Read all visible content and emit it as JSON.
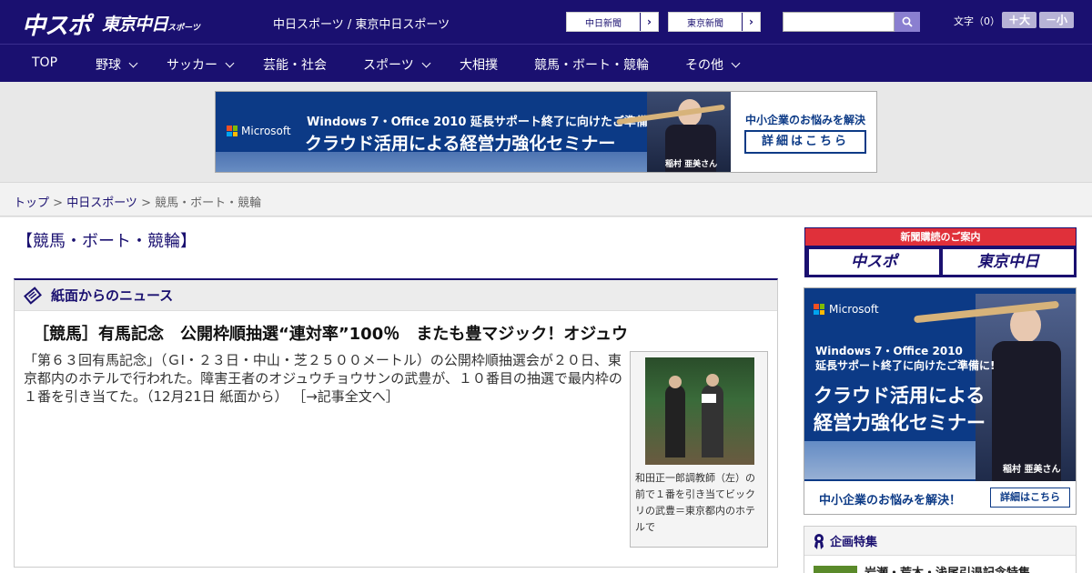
{
  "header": {
    "logo_main": "中スポ",
    "logo_sub": "東京中日",
    "logo_sub_small": "スポーツ",
    "site_title": "中日スポーツ / 東京中日スポーツ",
    "paper_chunichi": "中日新聞",
    "paper_tokyo": "東京新聞",
    "search_placeholder": "",
    "font_label": "文字（0）",
    "font_bigger": "＋大",
    "font_smaller": "－小"
  },
  "nav": {
    "items": [
      {
        "label": "TOP"
      },
      {
        "label": "野球"
      },
      {
        "label": "サッカー"
      },
      {
        "label": "芸能・社会"
      },
      {
        "label": "スポーツ"
      },
      {
        "label": "大相撲"
      },
      {
        "label": "競馬・ボート・競輪"
      },
      {
        "label": "その他"
      }
    ]
  },
  "banner_ad": {
    "brand": "Microsoft",
    "line1": "Windows 7・Office 2010 延長サポート終了に向けたご準備に!",
    "line2": "クラウド活用による経営力強化セミナー",
    "person": "稲村 亜美さん",
    "question": "中小企業のお悩みを解決",
    "cta": "詳細はこちら"
  },
  "breadcrumb": {
    "home": "トップ",
    "sep": " > ",
    "parent": "中日スポーツ",
    "current": "競馬・ボート・競輪"
  },
  "page": {
    "heading": "【競馬・ボート・競輪】"
  },
  "news": {
    "section_title": "紙面からのニュース",
    "title": "［競馬］有馬記念　公開枠順抽選“連対率”100％　またも豊マジック！オジュウ",
    "body": "「第６３回有馬記念」（ＧⅠ・２３日・中山・芝２５００メートル）の公開枠順抽選会が２０日、東京都内のホテルで行われた。障害王者のオジュウチョウサンの武豊が、１０番目の抽選で最内枠の１番を引き当てた。（12月21日 紙面から）",
    "more": "［→記事全文へ］",
    "photo_caption": "和田正一郎調教師（左）の前で１番を引き当てビックリの武豊＝東京都内のホテルで"
  },
  "sidebar": {
    "subscribe_head": "新聞購読のご案内",
    "subscribe_a": "中スポ",
    "subscribe_b": "東京中日",
    "side_ad": {
      "brand": "Microsoft",
      "line1": "Windows 7・Office 2010",
      "line2": "延長サポート終了に向けたご準備に!",
      "line3": "クラウド活用による",
      "line4": "経営力強化セミナー",
      "person": "稲村 亜美さん",
      "question": "中小企業のお悩みを解決！",
      "cta": "詳細はこちら"
    },
    "feature_title": "企画特集",
    "feature_item": "岩瀬・荒木・浅尾引退記念特集"
  },
  "colors": {
    "brand_navy": "#1a1070",
    "accent_red": "#e0303a",
    "ad_blue": "#0c3a86"
  }
}
